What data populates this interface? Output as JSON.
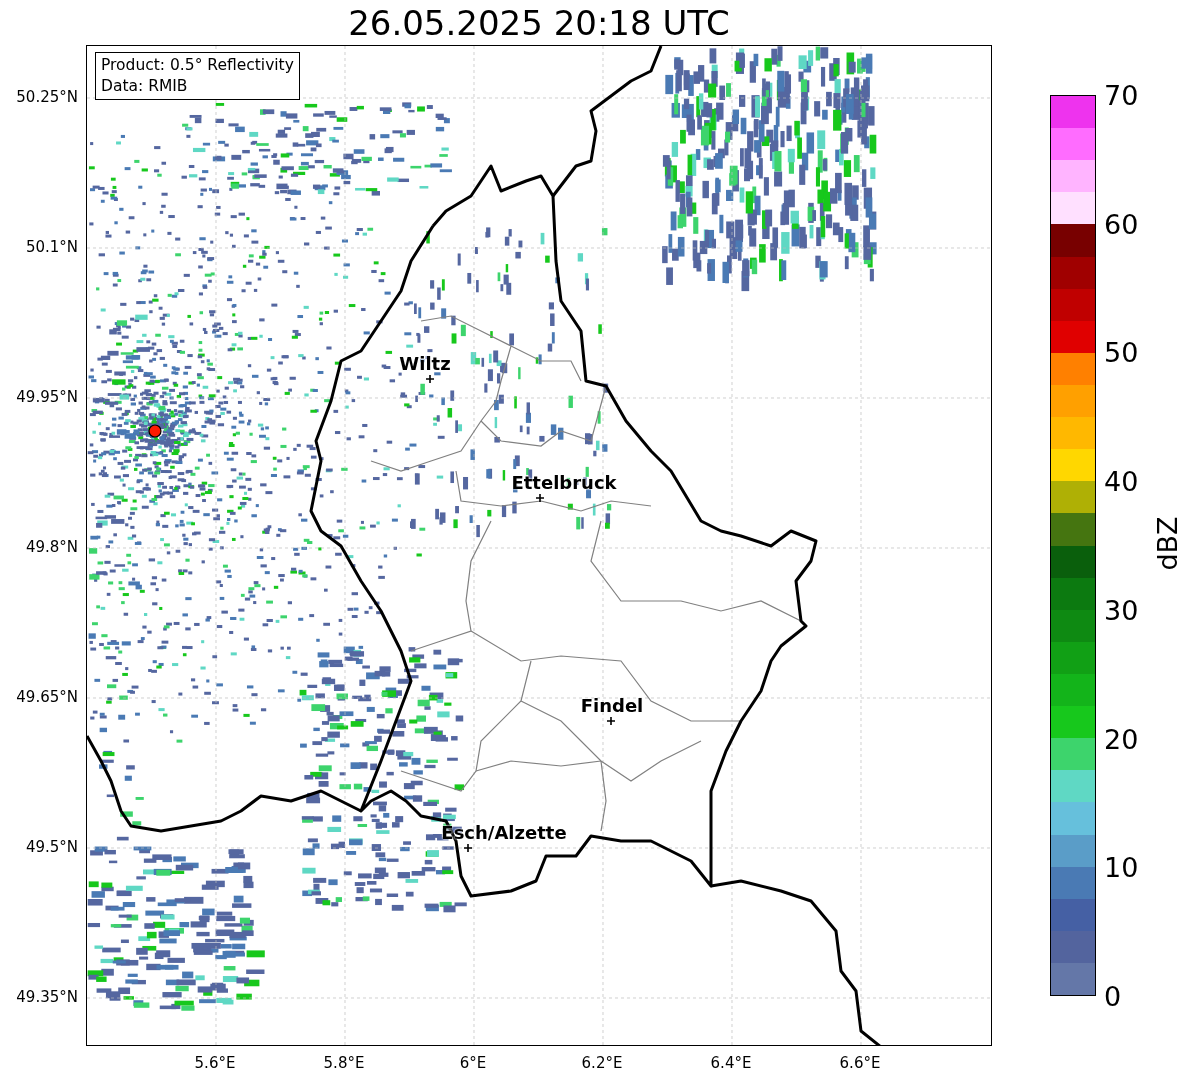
{
  "title": "26.05.2025 20:18 UTC",
  "legend": [
    "Product: 0.5° Reflectivity",
    "Data: RMIB"
  ],
  "lat_ticks": [
    "50.25°N",
    "50.1°N",
    "49.95°N",
    "49.8°N",
    "49.65°N",
    "49.5°N",
    "49.35°N"
  ],
  "lon_ticks": [
    "5.6°E",
    "5.8°E",
    "6°E",
    "6.2°E",
    "6.4°E",
    "6.6°E"
  ],
  "cities": [
    {
      "name": "Wiltz"
    },
    {
      "name": "Ettelbruck"
    },
    {
      "name": "Findel"
    },
    {
      "name": "Esch/Alzette"
    }
  ],
  "colorbar": {
    "label": "dBZ",
    "ticks": [
      "70",
      "60",
      "50",
      "40",
      "30",
      "20",
      "10",
      "0"
    ],
    "segments": [
      {
        "color": "#ee33ee"
      },
      {
        "color": "#ff6cff"
      },
      {
        "color": "#ffb4ff"
      },
      {
        "color": "#ffe0ff"
      },
      {
        "color": "#780000"
      },
      {
        "color": "#a00000"
      },
      {
        "color": "#c00000"
      },
      {
        "color": "#e00000"
      },
      {
        "color": "#ff8000"
      },
      {
        "color": "#ffa000"
      },
      {
        "color": "#ffb800"
      },
      {
        "color": "#ffd700"
      },
      {
        "color": "#afb005"
      },
      {
        "color": "#457510"
      },
      {
        "color": "#0a5f0c"
      },
      {
        "color": "#0c7a10"
      },
      {
        "color": "#0e8a12"
      },
      {
        "color": "#11a015"
      },
      {
        "color": "#13b41a"
      },
      {
        "color": "#17c81c"
      },
      {
        "color": "#3dd46c"
      },
      {
        "color": "#5fd8c4"
      },
      {
        "color": "#66c0dc"
      },
      {
        "color": "#5a9dc8"
      },
      {
        "color": "#4a7ab4"
      },
      {
        "color": "#4560a4"
      },
      {
        "color": "#53649e"
      },
      {
        "color": "#6477a8"
      }
    ]
  }
}
